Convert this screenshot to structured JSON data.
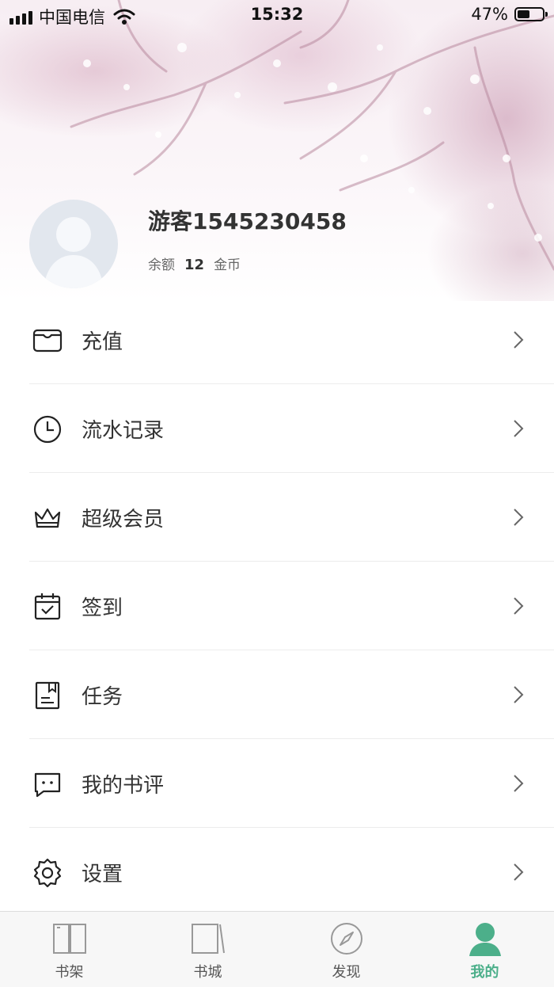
{
  "status_bar": {
    "carrier": "中国电信",
    "time": "15:32",
    "battery": "47%"
  },
  "profile": {
    "username": "游客1545230458",
    "balance_label": "余额",
    "balance_value": "12",
    "currency": "金币"
  },
  "menu": [
    {
      "label": "充值",
      "icon": "wallet-icon"
    },
    {
      "label": "流水记录",
      "icon": "clock-icon"
    },
    {
      "label": "超级会员",
      "icon": "crown-icon"
    },
    {
      "label": "签到",
      "icon": "calendar-check-icon"
    },
    {
      "label": "任务",
      "icon": "task-doc-icon"
    },
    {
      "label": "我的书评",
      "icon": "comment-icon"
    },
    {
      "label": "设置",
      "icon": "gear-icon"
    }
  ],
  "tabbar": [
    {
      "label": "书架",
      "icon": "open-book-icon"
    },
    {
      "label": "书城",
      "icon": "bookstore-icon"
    },
    {
      "label": "发现",
      "icon": "compass-icon"
    },
    {
      "label": "我的",
      "icon": "person-icon",
      "active": true
    }
  ],
  "colors": {
    "accent": "#4caf8a",
    "text": "#333333",
    "divider": "#ececec"
  }
}
